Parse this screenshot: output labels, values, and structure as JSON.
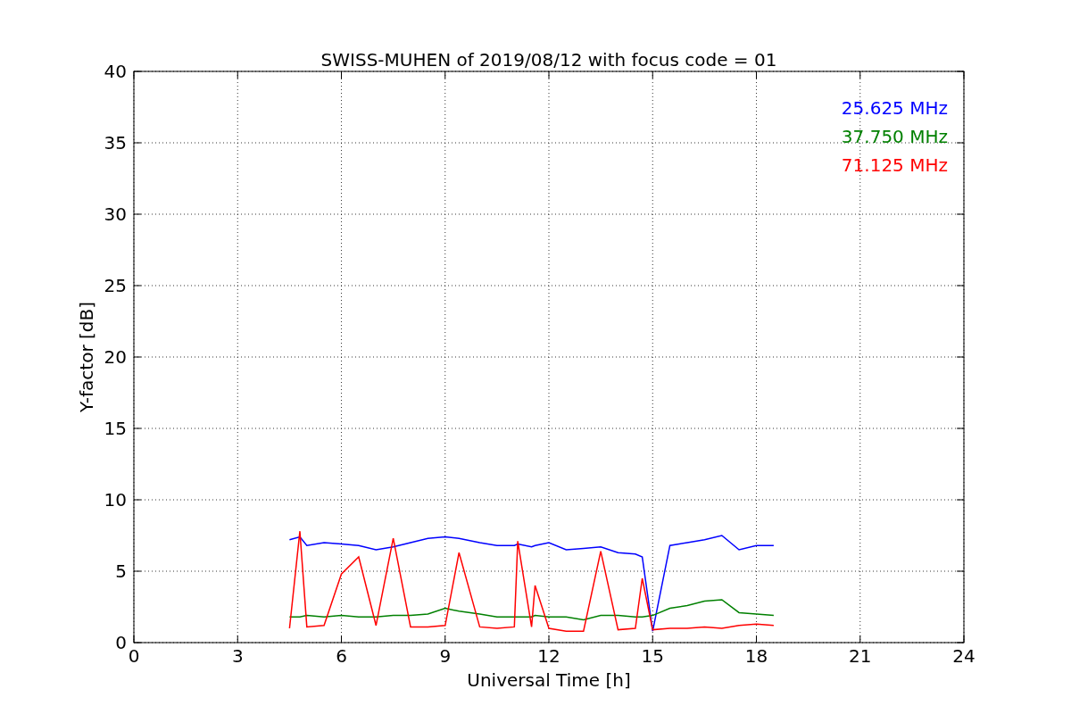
{
  "chart_data": {
    "type": "line",
    "title": "SWISS-MUHEN of 2019/08/12 with focus code = 01",
    "xlabel": "Universal Time [h]",
    "ylabel": "Y-factor [dB]",
    "x": [
      4.5,
      4.8,
      5,
      5.5,
      6,
      6.5,
      7,
      7.5,
      8,
      8.5,
      9,
      9.4,
      10,
      10.5,
      11,
      11.1,
      11.5,
      11.6,
      12,
      12.5,
      13,
      13.5,
      14,
      14.5,
      14.7,
      15,
      15.5,
      16,
      16.5,
      17,
      17.5,
      18,
      18.5
    ],
    "series": [
      {
        "name": "25.625 MHz",
        "color": "#0000ff",
        "values": [
          7.2,
          7.4,
          6.8,
          7.0,
          6.9,
          6.8,
          6.5,
          6.7,
          7.0,
          7.3,
          7.4,
          7.3,
          7.0,
          6.8,
          6.8,
          6.9,
          6.7,
          6.8,
          7.0,
          6.5,
          6.6,
          6.7,
          6.3,
          6.2,
          6.0,
          0.8,
          6.8,
          7.0,
          7.2,
          7.5,
          6.5,
          6.8,
          6.8
        ]
      },
      {
        "name": "37.750 MHz",
        "color": "#008000",
        "values": [
          1.8,
          1.8,
          1.9,
          1.8,
          1.9,
          1.8,
          1.8,
          1.9,
          1.9,
          2.0,
          2.4,
          2.2,
          2.0,
          1.8,
          1.8,
          1.8,
          1.8,
          1.9,
          1.8,
          1.8,
          1.6,
          1.9,
          1.9,
          1.8,
          1.8,
          1.9,
          2.4,
          2.6,
          2.9,
          3.0,
          2.1,
          2.0,
          1.9
        ]
      },
      {
        "name": "71.125 MHz",
        "color": "#ff0000",
        "values": [
          1.0,
          7.8,
          1.1,
          1.2,
          4.8,
          6.0,
          1.2,
          7.3,
          1.1,
          1.1,
          1.2,
          6.3,
          1.1,
          1.0,
          1.1,
          7.1,
          1.1,
          4.0,
          1.0,
          0.8,
          0.8,
          6.4,
          0.9,
          1.0,
          4.5,
          0.9,
          1.0,
          1.0,
          1.1,
          1.0,
          1.2,
          1.3,
          1.2
        ]
      }
    ],
    "grid": true,
    "xlim": [
      0,
      24
    ],
    "ylim": [
      0,
      40
    ],
    "xticks": [
      0,
      3,
      6,
      9,
      12,
      15,
      18,
      21,
      24
    ],
    "yticks": [
      0,
      5,
      10,
      15,
      20,
      25,
      30,
      35,
      40
    ]
  }
}
